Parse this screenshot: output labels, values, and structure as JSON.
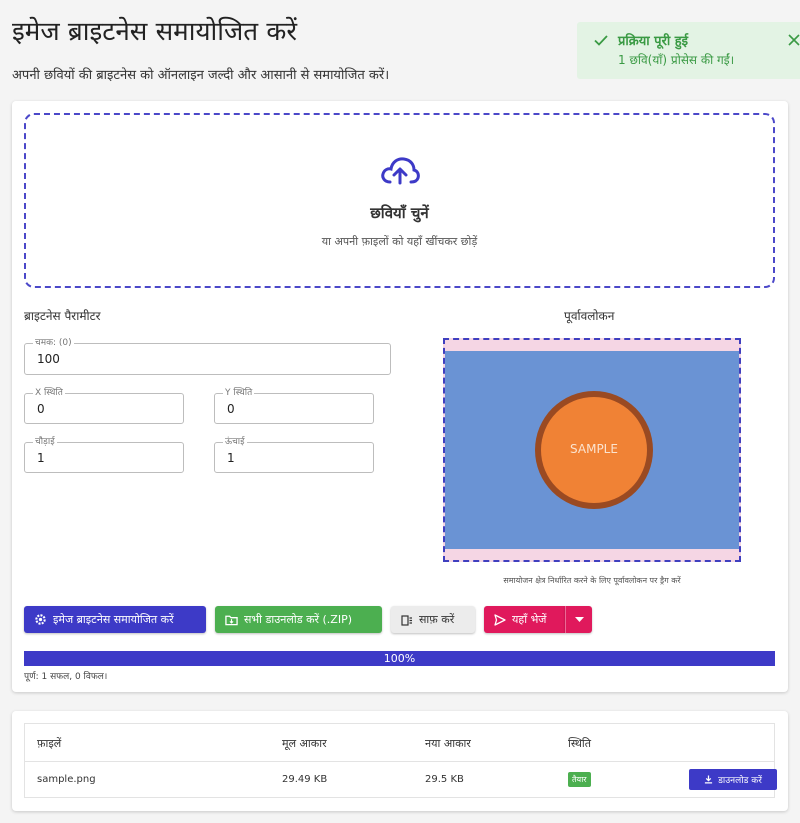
{
  "header": {
    "title": "इमेज ब्राइटनेस समायोजित करें",
    "subtitle": "अपनी छवियों की ब्राइटनेस को ऑनलाइन जल्दी और आसानी से समायोजित करें।"
  },
  "toast": {
    "title": "प्रक्रिया पूरी हुई",
    "message": "1 छवि(याँ) प्रोसेस की गईं।",
    "color": "#3a9a44"
  },
  "dropzone": {
    "title": "छवियाँ चुनें",
    "hint": "या अपनी फ़ाइलों को यहाँ खींचकर छोड़ें",
    "icon": "cloud-upload-icon"
  },
  "params": {
    "section_title": "ब्राइटनेस पैरामीटर",
    "brightness": {
      "label": "चमक: (0)",
      "value": "100"
    },
    "x": {
      "label": "X स्थिति",
      "value": "0"
    },
    "y": {
      "label": "Y स्थिति",
      "value": "0"
    },
    "width": {
      "label": "चौड़ाई",
      "value": "1"
    },
    "height": {
      "label": "ऊंचाई",
      "value": "1"
    }
  },
  "preview": {
    "title": "पूर्वावलोकन",
    "sample_text": "SAMPLE",
    "hint": "समायोजन क्षेत्र निर्धारित करने के लिए पूर्वावलोकन पर ड्रैग करें"
  },
  "actions": {
    "adjust": "इमेज ब्राइटनेस समायोजित करें",
    "download_all": "सभी डाउनलोड करें (.ZIP)",
    "clear": "साफ़ करें",
    "send": "यहाँ भेजें"
  },
  "progress": {
    "percent_label": "100%",
    "percent": 100,
    "status": "पूर्ण: 1 सफल, 0 विफल।"
  },
  "files": {
    "headers": [
      "फ़ाइलें",
      "मूल आकार",
      "नया आकार",
      "स्थिति"
    ],
    "rows": [
      {
        "name": "sample.png",
        "original_size": "29.49 KB",
        "new_size": "29.5 KB",
        "status": "तैयार",
        "download": "डाउनलोड करें"
      }
    ]
  },
  "colors": {
    "primary": "#3d3ac7",
    "success": "#4caf50",
    "accent": "#e0195c"
  }
}
